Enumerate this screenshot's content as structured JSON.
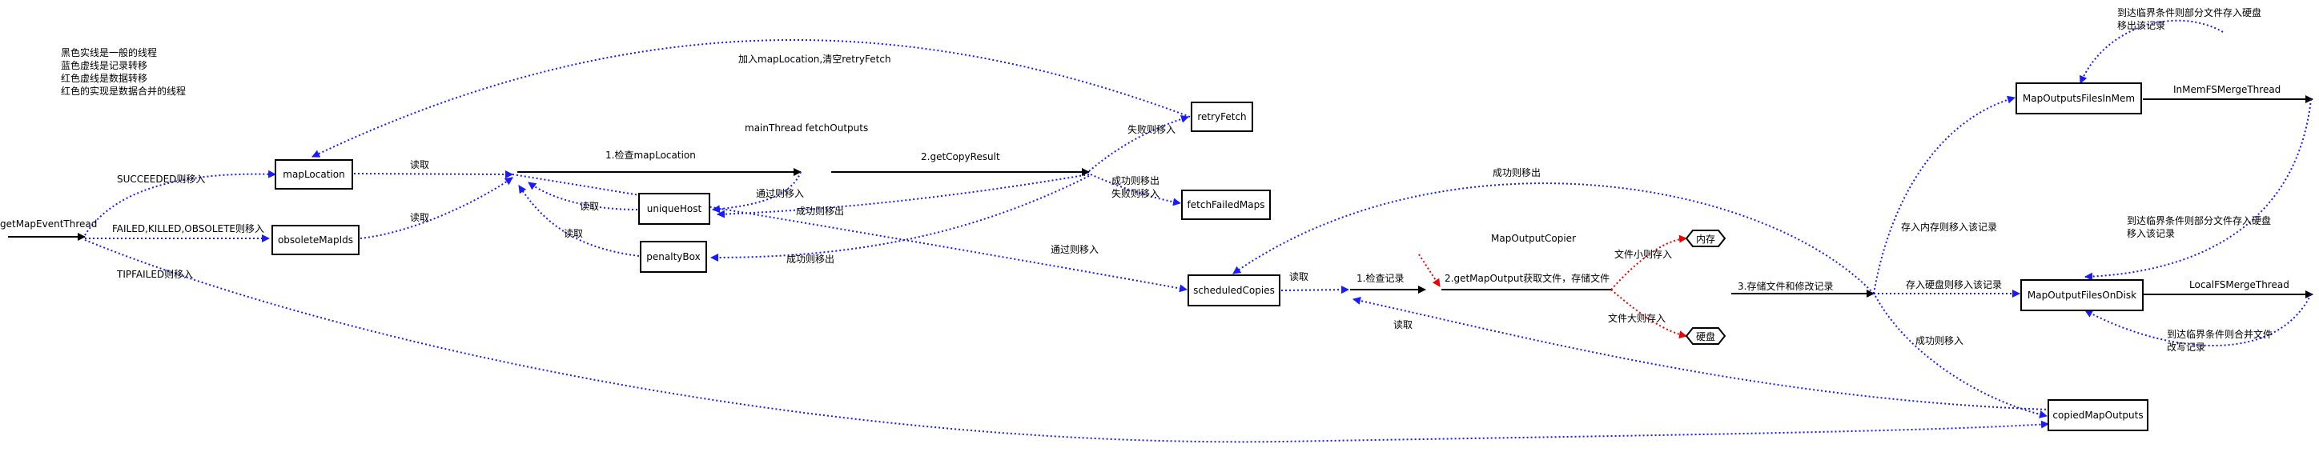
{
  "legend": [
    "黑色实线是一般的线程",
    "蓝色虚线是记录转移",
    "红色虚线是数据转移",
    "红色的实现是数据合并的线程"
  ],
  "titles": {
    "main_thread": "mainThread fetchOutputs",
    "copier": "MapOutputCopier"
  },
  "nodes": {
    "get_map_event": "getMapEventThread",
    "map_location": "mapLocation",
    "obsolete_map_ids": "obsoleteMapIds",
    "unique_host": "uniqueHost",
    "penalty_box": "penaltyBox",
    "retry_fetch": "retryFetch",
    "fetch_failed_maps": "fetchFailedMaps",
    "scheduled_copies": "scheduledCopies",
    "memory": "内存",
    "disk": "硬盘",
    "map_outputs_in_mem": "MapOutputsFilesInMem",
    "map_output_files_on_disk": "MapOutputFilesOnDisk",
    "copied_map_outputs": "copiedMapOutputs"
  },
  "labels": {
    "succeeded": "SUCCEEDED则移入",
    "failed_killed": "FAILED,KILLED,OBSOLETE则移入",
    "tipfailed": "TIPFAILED则移入",
    "read1": "读取",
    "read2": "读取",
    "read3": "读取",
    "read4": "读取",
    "read5": "读取",
    "read6": "读取",
    "add_map_location": "加入mapLocation,清空retryFetch",
    "check_map_location": "1.检查mapLocation",
    "get_copy_result": "2.getCopyResult",
    "pass_then_move": "通过则移入",
    "success_move_out_1": "成功则移出",
    "success_move_out_2": "成功则移出",
    "fail_then_move": "失败则移入",
    "success_fail_1": "成功则移出",
    "success_fail_2": "失败则移入",
    "pass_then_move_2": "通过则移入",
    "success_move_out_3": "成功则移出",
    "check_record": "1.检查记录",
    "get_map_output": "2.getMapOutput获取文件，存储文件",
    "small_file": "文件小则存入",
    "large_file": "文件大则存入",
    "store_and_modify": "3.存储文件和修改记录",
    "mem_store": "存入内存则移入该记录",
    "disk_store": "存入硬盘则移入该记录",
    "success_move_in": "成功则移入",
    "in_mem_merge": "InMemFSMergeThread",
    "local_merge": "LocalFSMergeThread",
    "threshold_mem_top_1": "到达临界条件则部分文件存入硬盘",
    "threshold_mem_top_2": "移出该记录",
    "threshold_disk_1": "到达临界条件则部分文件存入硬盘",
    "threshold_disk_2": "移入该记录",
    "threshold_merge_1": "到达临界条件则合并文件",
    "threshold_merge_2": "改写记录"
  }
}
